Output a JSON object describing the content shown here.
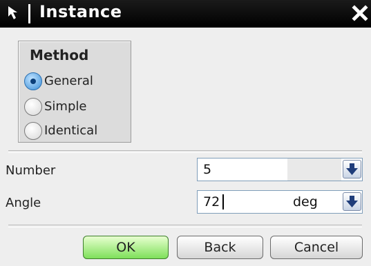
{
  "window": {
    "title": "Instance"
  },
  "method": {
    "title": "Method",
    "options": [
      {
        "label": "General",
        "checked": true
      },
      {
        "label": "Simple",
        "checked": false
      },
      {
        "label": "Identical",
        "checked": false
      }
    ]
  },
  "fields": {
    "number": {
      "label": "Number",
      "value": "5"
    },
    "angle": {
      "label": "Angle",
      "value": "72",
      "unit": "deg"
    }
  },
  "buttons": {
    "ok": "OK",
    "back": "Back",
    "cancel": "Cancel"
  },
  "icons": {
    "title": "arrow-select-icon",
    "close": "close-icon",
    "dropdown": "chevron-down-arrow-icon"
  },
  "colors": {
    "titlebar": "#000000",
    "ok_button": "#7ee05a",
    "radio_selected": "#3b8fd8"
  }
}
